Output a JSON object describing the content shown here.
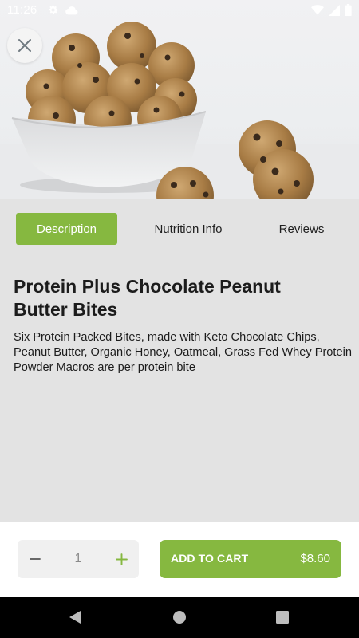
{
  "status_bar": {
    "time": "11:26",
    "icons": [
      "gear-icon",
      "cloud-icon",
      "wifi-icon",
      "signal-icon",
      "battery-icon"
    ]
  },
  "hero": {
    "close_icon": "close-icon"
  },
  "tabs": [
    {
      "label": "Description",
      "active": true
    },
    {
      "label": "Nutrition Info",
      "active": false
    },
    {
      "label": "Reviews",
      "active": false
    }
  ],
  "product": {
    "title": "Protein Plus Chocolate Peanut Butter Bites",
    "description": "Six Protein Packed Bites, made with Keto Chocolate Chips, Peanut Butter, Organic Honey, Oatmeal, Grass Fed Whey Protein Powder Macros are per protein bite"
  },
  "cart": {
    "quantity": "1",
    "add_label": "ADD TO CART",
    "price": "$8.60"
  },
  "colors": {
    "accent": "#86b840",
    "background": "#e3e3e3"
  }
}
